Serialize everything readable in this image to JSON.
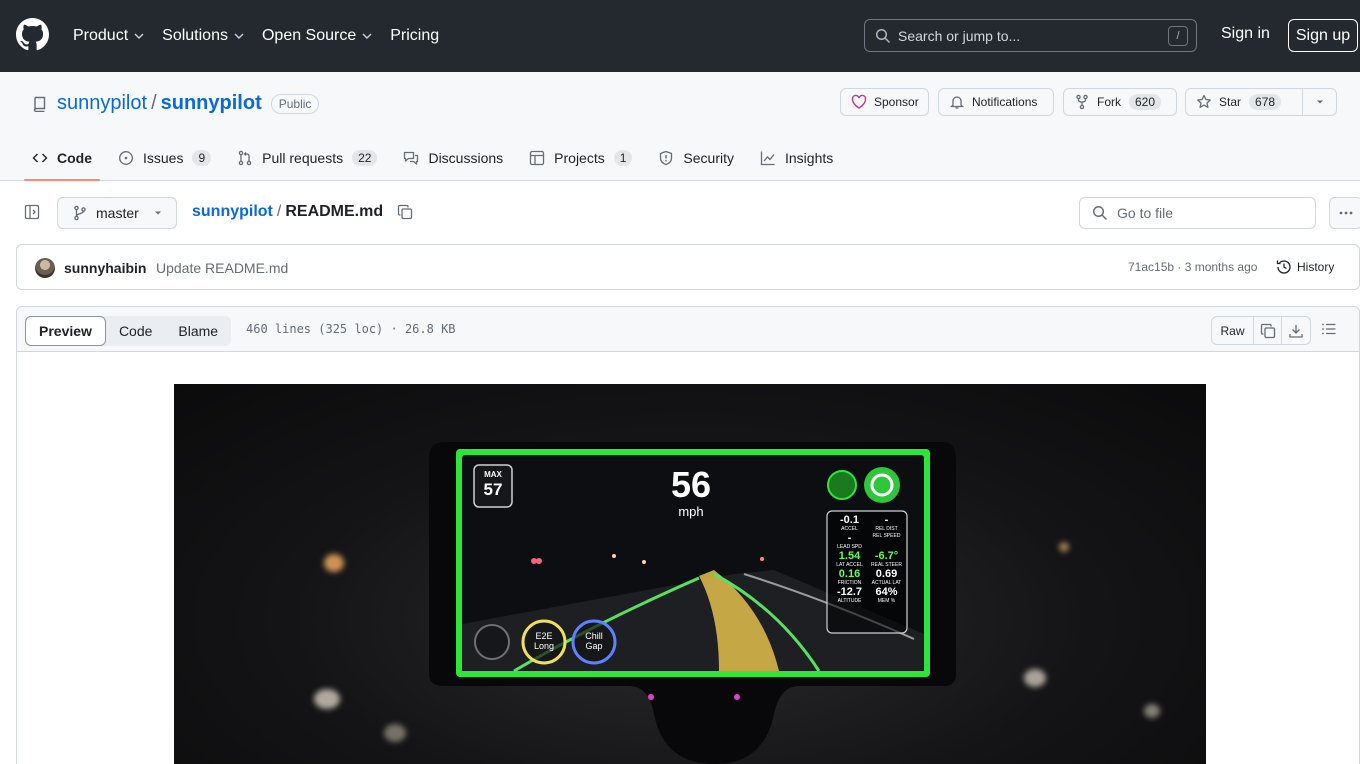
{
  "header": {
    "nav": [
      "Product",
      "Solutions",
      "Open Source",
      "Pricing"
    ],
    "search_placeholder": "Search or jump to...",
    "search_shortcut": "/",
    "sign_in": "Sign in",
    "sign_up": "Sign up"
  },
  "repo": {
    "owner": "sunnypilot",
    "name": "sunnypilot",
    "visibility": "Public",
    "sponsor": "Sponsor",
    "notifications": "Notifications",
    "fork": "Fork",
    "fork_count": "620",
    "star": "Star",
    "star_count": "678"
  },
  "tabs": [
    {
      "label": "Code",
      "count": ""
    },
    {
      "label": "Issues",
      "count": "9"
    },
    {
      "label": "Pull requests",
      "count": "22"
    },
    {
      "label": "Discussions",
      "count": ""
    },
    {
      "label": "Projects",
      "count": "1"
    },
    {
      "label": "Security",
      "count": ""
    },
    {
      "label": "Insights",
      "count": ""
    }
  ],
  "file": {
    "branch": "master",
    "repo": "sunnypilot",
    "filename": "README.md",
    "goto_placeholder": "Go to file"
  },
  "commit": {
    "author": "sunnyhaibin",
    "message": "Update README.md",
    "sha_time": "71ac15b · 3 months ago",
    "history": "History"
  },
  "viewer": {
    "modes": [
      "Preview",
      "Code",
      "Blame"
    ],
    "lines": "460 lines (325 loc) · 26.8 KB",
    "raw": "Raw"
  },
  "hud": {
    "max_label": "MAX",
    "max_value": "57",
    "speed": "56",
    "unit": "mph",
    "e2e": "E2E Long",
    "chill": "Chill Gap",
    "stats": [
      {
        "value": "-0.1",
        "label": "ACCEL"
      },
      {
        "value": "-",
        "label": "REL DIST"
      },
      {
        "value": "-",
        "label": "LEAD SPD"
      },
      {
        "value": "",
        "label": "REL SPEED"
      },
      {
        "value": "1.54",
        "label": "LAT ACCEL"
      },
      {
        "value": "-6.7°",
        "label": "REAL STEER"
      },
      {
        "value": "0.16",
        "label": "FRICTION"
      },
      {
        "value": "0.69",
        "label": "ACTUAL LAT"
      },
      {
        "value": "-12.7",
        "label": "ALTITUDE"
      },
      {
        "value": "64%",
        "label": "MEM %"
      }
    ]
  }
}
